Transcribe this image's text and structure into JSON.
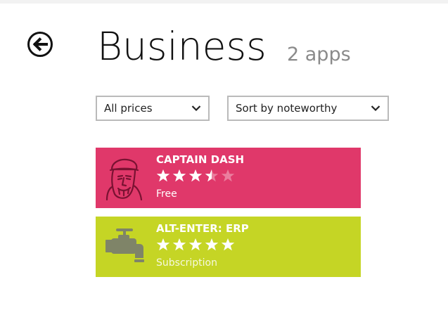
{
  "header": {
    "title": "Business",
    "app_count": "2 apps"
  },
  "filters": {
    "price": "All prices",
    "sort": "Sort by noteworthy"
  },
  "apps": [
    {
      "name": "CAPTAIN DASH",
      "rating": 3.5,
      "price": "Free",
      "tile_color": "#e0386a",
      "icon": "captain-portrait-icon"
    },
    {
      "name": "ALT-ENTER: ERP",
      "rating": 5,
      "price": "Subscription",
      "tile_color": "#c5d525",
      "icon": "water-faucet-icon"
    }
  ],
  "colors": {
    "title_text": "#111111",
    "count_text": "#8a8a8a",
    "dropdown_border": "#bababa"
  }
}
